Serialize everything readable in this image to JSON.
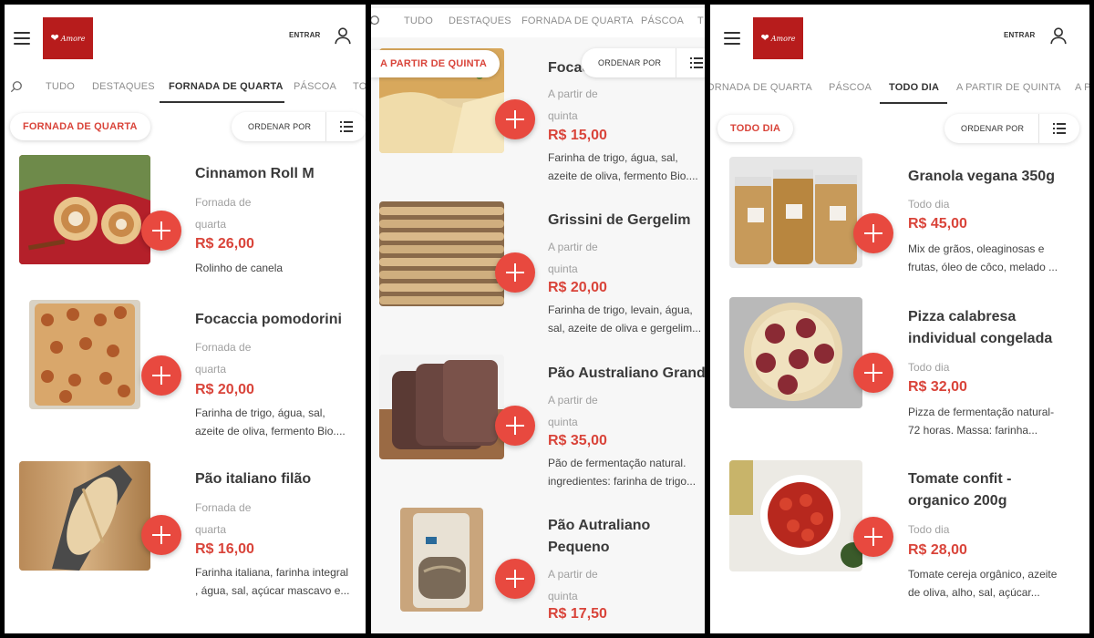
{
  "header": {
    "login_label": "ENTRAR"
  },
  "sort_label": "ORDENAR POR",
  "panel1": {
    "nav": [
      "TUDO",
      "DESTAQUES",
      "FORNADA DE QUARTA",
      "PÁSCOA",
      "TO"
    ],
    "active_tab": "FORNADA DE QUARTA",
    "section": "FORNADA DE QUARTA",
    "products": [
      {
        "title": "Cinnamon Roll M",
        "avail1": "Fornada de",
        "avail2": "quarta",
        "price": "R$ 26,00",
        "desc1": "Rolinho de canela",
        "desc2": ""
      },
      {
        "title": "Focaccia pomodorini",
        "avail1": "Fornada de",
        "avail2": "quarta",
        "price": "R$ 20,00",
        "desc1": "Farinha de trigo, água, sal,",
        "desc2": "azeite de oliva, fermento Bio...."
      },
      {
        "title": "Pão italiano filão",
        "avail1": "Fornada de",
        "avail2": "quarta",
        "price": "R$ 16,00",
        "desc1": "Farinha italiana, farinha integral",
        "desc2": ", água, sal, açúcar mascavo e..."
      }
    ]
  },
  "panel2": {
    "nav": [
      "TUDO",
      "DESTAQUES",
      "FORNADA DE QUARTA",
      "PÁSCOA",
      "T"
    ],
    "section": "A PARTIR DE QUINTA",
    "products": [
      {
        "title": "Focac",
        "title2": "",
        "avail1": "A partir de",
        "avail2": "quinta",
        "price": "R$ 15,00",
        "desc1": "Farinha de trigo, água, sal,",
        "desc2": "azeite de oliva, fermento Bio...."
      },
      {
        "title": "Grissini de Gergelim",
        "title2": "",
        "avail1": "A partir de",
        "avail2": "quinta",
        "price": "R$ 20,00",
        "desc1": "Farinha de trigo, levain, água,",
        "desc2": "sal, azeite de oliva e gergelim..."
      },
      {
        "title": "Pão Australiano Grande",
        "title2": "",
        "avail1": "A partir de",
        "avail2": "quinta",
        "price": "R$ 35,00",
        "desc1": "Pão de fermentação natural.",
        "desc2": "ingredientes: farinha de trigo..."
      },
      {
        "title": "Pão Autraliano",
        "title2": "Pequeno",
        "avail1": "A partir de",
        "avail2": "quinta",
        "price": "R$ 17,50",
        "desc1": "",
        "desc2": ""
      }
    ]
  },
  "panel3": {
    "nav": [
      "ORNADA DE QUARTA",
      "PÁSCOA",
      "TODO DIA",
      "A PARTIR DE QUINTA",
      "A P"
    ],
    "active_tab": "TODO DIA",
    "section": "TODO DIA",
    "products": [
      {
        "title": "Granola vegana 350g",
        "title2": "",
        "avail1": "Todo dia",
        "price": "R$ 45,00",
        "desc1": "Mix de grãos, oleaginosas e",
        "desc2": "frutas, óleo de côco, melado ..."
      },
      {
        "title": "Pizza calabresa",
        "title2": "individual congelada",
        "avail1": "Todo dia",
        "price": "R$ 32,00",
        "desc1": "Pizza de fermentação natural-",
        "desc2": "72 horas. Massa: farinha..."
      },
      {
        "title": "Tomate confit -",
        "title2": "organico 200g",
        "avail1": "Todo dia",
        "price": "R$ 28,00",
        "desc1": "Tomate cereja orgânico, azeite",
        "desc2": "de oliva, alho, sal, açúcar..."
      }
    ]
  },
  "colors": {
    "accent": "#e8493f",
    "price": "#d9443a",
    "logo_bg": "#b71c1c"
  },
  "icons": [
    "menu-icon",
    "user-icon",
    "search-icon",
    "list-icon",
    "plus-icon"
  ]
}
